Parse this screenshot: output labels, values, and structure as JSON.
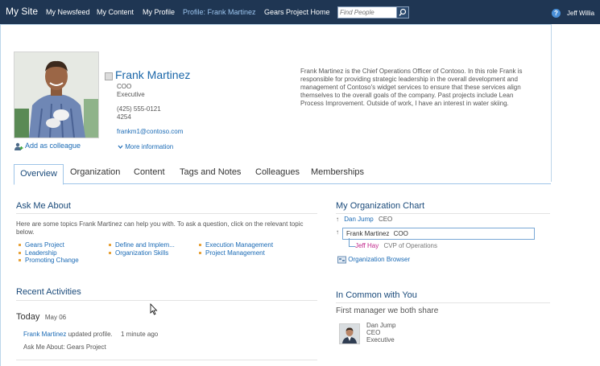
{
  "topbar": {
    "site_title": "My Site",
    "nav": [
      "My Newsfeed",
      "My Content",
      "My Profile",
      "Profile: Frank Martinez",
      "Gears Project Home"
    ],
    "search_placeholder": "Find People",
    "help": "?",
    "user": "Jeff Willia"
  },
  "profile": {
    "name": "Frank Martinez",
    "title": "COO",
    "department": "Executive",
    "phone": "(425) 555-0121",
    "extension": "4254",
    "email": "frankm1@contoso.com",
    "more_info": "More information",
    "add_colleague": "Add as colleague",
    "about": "Frank Martinez is the Chief Operations Officer of Contoso. In this role Frank is responsible for providing strategic leadership in the overall development and management of Contoso's widget services to ensure that these services align themselves to the overall goals of the company. Past projects include Lean Process Improvement. Outside of work, I have an interest in water skiing."
  },
  "tabs": [
    "Overview",
    "Organization",
    "Content",
    "Tags and Notes",
    "Colleagues",
    "Memberships"
  ],
  "ask_me_about": {
    "title": "Ask Me About",
    "intro": "Here are some topics Frank Martinez can help you with. To ask a question, click on the relevant topic below.",
    "topics": [
      "Gears Project",
      "Leadership",
      "Promoting Change",
      "Define and Implem...",
      "Organization Skills",
      "Execution Management",
      "Project Management"
    ]
  },
  "recent": {
    "title": "Recent Activities",
    "day": "Today",
    "date": "May 06",
    "activity_name": "Frank Martinez",
    "activity_text": "updated profile.",
    "activity_time": "1 minute ago",
    "detail": "Ask Me About: Gears Project"
  },
  "org_chart": {
    "title": "My Organization Chart",
    "manager_name": "Dan Jump",
    "manager_title": "CEO",
    "self_name": "Frank Martinez",
    "self_title": "COO",
    "report_name": "Jeff Hay",
    "report_title": "CVP of Operations",
    "browser": "Organization Browser"
  },
  "in_common": {
    "title": "In Common with You",
    "subtitle": "First manager we both share",
    "name": "Dan Jump",
    "title2": "CEO",
    "department": "Executive"
  },
  "colors": {
    "topbar": "#1f3653",
    "link": "#1a6ab5",
    "heading": "#1a4a7a",
    "bullet": "#e8a33b",
    "report": "#c0268b"
  }
}
